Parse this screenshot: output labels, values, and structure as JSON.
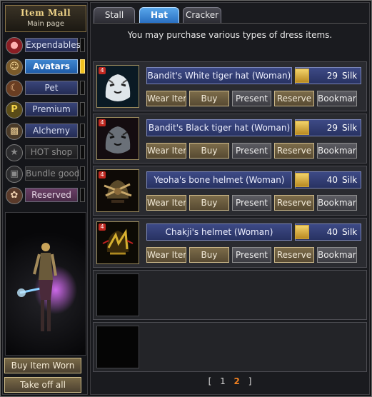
{
  "header": {
    "title": "Item Mall",
    "subtitle": "Main page"
  },
  "categories": [
    {
      "label": "Expendables",
      "icon": "potion-icon",
      "state": "normal"
    },
    {
      "label": "Avatars",
      "icon": "avatar-face-icon",
      "state": "active"
    },
    {
      "label": "Pet",
      "icon": "pet-icon",
      "state": "normal"
    },
    {
      "label": "Premium",
      "icon": "premium-p-icon",
      "state": "normal"
    },
    {
      "label": "Alchemy",
      "icon": "alchemy-icon",
      "state": "normal"
    },
    {
      "label": "HOT shop",
      "icon": "hot-shop-icon",
      "state": "disabled"
    },
    {
      "label": "Bundle goods",
      "icon": "bundle-icon",
      "state": "disabled"
    },
    {
      "label": "Reserved",
      "icon": "reserved-icon",
      "state": "reserved"
    }
  ],
  "side_buttons": {
    "buy_worn": "Buy Item Worn",
    "take_off": "Take off all"
  },
  "tabs": [
    {
      "label": "Stall",
      "active": false
    },
    {
      "label": "Hat",
      "active": true
    },
    {
      "label": "Cracker",
      "active": false
    }
  ],
  "description": "You may purchase various types of dress items.",
  "items": [
    {
      "name": "Bandit's White tiger hat (Woman)",
      "price": "29",
      "currency": "Silk",
      "image": "white-tiger-hat-icon"
    },
    {
      "name": "Bandit's Black tiger hat (Woman)",
      "price": "29",
      "currency": "Silk",
      "image": "black-tiger-hat-icon"
    },
    {
      "name": "Yeoha's bone helmet (Woman)",
      "price": "40",
      "currency": "Silk",
      "image": "bone-helmet-icon"
    },
    {
      "name": "Chakji's helmet (Woman)",
      "price": "40",
      "currency": "Silk",
      "image": "chakji-helmet-icon"
    }
  ],
  "actions": {
    "wear": "Wear Item",
    "buy": "Buy",
    "present": "Present",
    "reserve": "Reserve",
    "bookmark": "Bookmark"
  },
  "badge_label": "4",
  "pager": {
    "open": "[",
    "pages": [
      "1",
      "2"
    ],
    "current": "2",
    "close": "]"
  },
  "colors": {
    "active_tab": "#2a70c2",
    "gold_accent": "#f0c020",
    "current_page": "#f08020"
  }
}
